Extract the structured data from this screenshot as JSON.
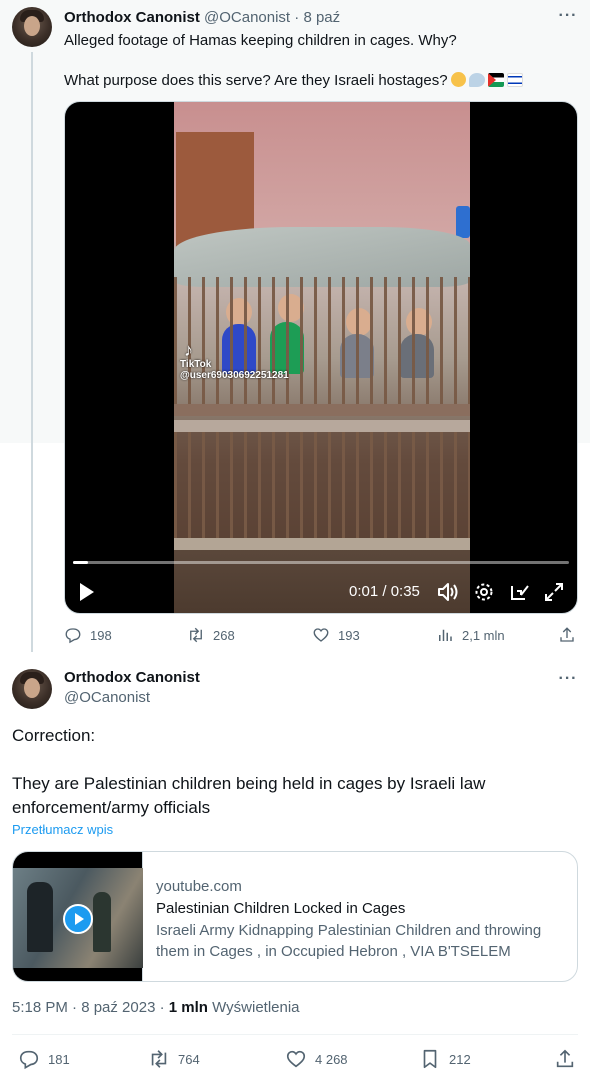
{
  "tweet1": {
    "author_name": "Orthodox Canonist",
    "handle": "@OCanonist",
    "date": "8 paź",
    "separator": "·",
    "text_line1": "Alleged footage of Hamas keeping children in cages. Why?",
    "text_line2": "What purpose does this serve? Are they Israeli hostages?",
    "emojis": [
      "thinking-face",
      "thought-balloon",
      "palestine-flag",
      "israel-flag"
    ],
    "video": {
      "watermark_logo": "TikTok",
      "watermark_user": "@user69030692251281",
      "current_time": "0:01",
      "duration": "0:35",
      "time_display": "0:01 / 0:35",
      "progress_fraction": 0.03
    },
    "stats": {
      "replies": "198",
      "reposts": "268",
      "likes": "193",
      "views": "2,1 mln"
    }
  },
  "tweet2": {
    "author_name": "Orthodox Canonist",
    "handle": "@OCanonist",
    "text_line1": "Correction:",
    "text_line2": "They are Palestinian children being held in cages by Israeli law enforcement/army officials",
    "translate_link": "Przetłumacz wpis",
    "card": {
      "domain": "youtube.com",
      "title": "Palestinian Children Locked in Cages",
      "description": "Israeli Army Kidnapping Palestinian Children and throwing them in Cages , in Occupied Hebron , VIA B'TSELEM"
    },
    "timestamp": "5:18 PM · 8 paź 2023 · ",
    "views_count": "1 mln",
    "views_label": "Wyświetlenia",
    "stats": {
      "replies": "181",
      "reposts": "764",
      "likes": "4 268",
      "bookmarks": "212"
    }
  },
  "colors": {
    "accent": "#1d9bf0",
    "secondary_text": "#536471",
    "primary_text": "#0f1419",
    "thread_highlight_bg": "#f7f9f9"
  }
}
